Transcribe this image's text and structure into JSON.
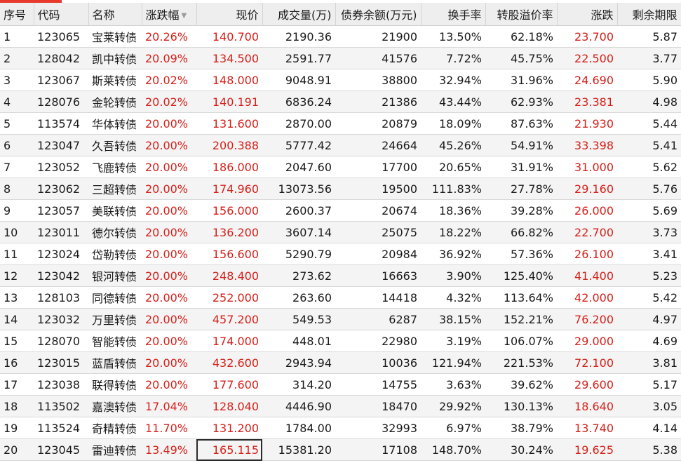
{
  "columns": [
    "序号",
    "代码",
    "名称",
    "涨跌幅",
    "现价",
    "成交量(万)",
    "债券余额(万元)",
    "换手率",
    "转股溢价率",
    "涨跌",
    "剩余期限"
  ],
  "sort_icon": "triangle-down-icon",
  "colors": {
    "up": "#d6201a",
    "accent": "#e8392d"
  },
  "rows": [
    [
      "1",
      "123065",
      "宝莱转债",
      "20.26%",
      "140.700",
      "2190.36",
      "21900",
      "13.50%",
      "62.18%",
      "23.700",
      "5.87"
    ],
    [
      "2",
      "128042",
      "凯中转债",
      "20.09%",
      "134.500",
      "2591.77",
      "41576",
      "7.72%",
      "45.75%",
      "22.500",
      "3.77"
    ],
    [
      "3",
      "123067",
      "斯莱转债",
      "20.02%",
      "148.000",
      "9048.91",
      "38800",
      "32.94%",
      "31.96%",
      "24.690",
      "5.90"
    ],
    [
      "4",
      "128076",
      "金轮转债",
      "20.02%",
      "140.191",
      "6836.24",
      "21386",
      "43.44%",
      "62.93%",
      "23.381",
      "4.98"
    ],
    [
      "5",
      "113574",
      "华体转债",
      "20.00%",
      "131.600",
      "2870.00",
      "20879",
      "18.09%",
      "87.63%",
      "21.930",
      "5.44"
    ],
    [
      "6",
      "123047",
      "久吾转债",
      "20.00%",
      "200.388",
      "5777.42",
      "24664",
      "45.26%",
      "54.91%",
      "33.398",
      "5.41"
    ],
    [
      "7",
      "123052",
      "飞鹿转债",
      "20.00%",
      "186.000",
      "2047.60",
      "17700",
      "20.65%",
      "31.91%",
      "31.000",
      "5.62"
    ],
    [
      "8",
      "123062",
      "三超转债",
      "20.00%",
      "174.960",
      "13073.56",
      "19500",
      "111.83%",
      "27.78%",
      "29.160",
      "5.76"
    ],
    [
      "9",
      "123057",
      "美联转债",
      "20.00%",
      "156.000",
      "2600.37",
      "20674",
      "18.36%",
      "39.28%",
      "26.000",
      "5.69"
    ],
    [
      "10",
      "123011",
      "德尔转债",
      "20.00%",
      "136.200",
      "3607.14",
      "25075",
      "18.22%",
      "66.82%",
      "22.700",
      "3.73"
    ],
    [
      "11",
      "123024",
      "岱勒转债",
      "20.00%",
      "156.600",
      "5290.79",
      "20984",
      "36.92%",
      "57.36%",
      "26.100",
      "3.41"
    ],
    [
      "12",
      "123042",
      "银河转债",
      "20.00%",
      "248.400",
      "273.62",
      "16663",
      "3.90%",
      "125.40%",
      "41.400",
      "5.23"
    ],
    [
      "13",
      "128103",
      "同德转债",
      "20.00%",
      "252.000",
      "263.60",
      "14418",
      "4.32%",
      "113.64%",
      "42.000",
      "5.42"
    ],
    [
      "14",
      "123032",
      "万里转债",
      "20.00%",
      "457.200",
      "549.53",
      "6287",
      "38.15%",
      "152.21%",
      "76.200",
      "4.97"
    ],
    [
      "15",
      "128070",
      "智能转债",
      "20.00%",
      "174.000",
      "448.01",
      "22980",
      "3.19%",
      "106.07%",
      "29.000",
      "4.69"
    ],
    [
      "16",
      "123015",
      "蓝盾转债",
      "20.00%",
      "432.600",
      "2943.94",
      "10036",
      "121.94%",
      "221.53%",
      "72.100",
      "3.81"
    ],
    [
      "17",
      "123038",
      "联得转债",
      "20.00%",
      "177.600",
      "314.20",
      "14755",
      "3.63%",
      "39.62%",
      "29.600",
      "5.17"
    ],
    [
      "18",
      "113502",
      "嘉澳转债",
      "17.04%",
      "128.040",
      "4446.90",
      "18470",
      "29.92%",
      "130.13%",
      "18.640",
      "3.05"
    ],
    [
      "19",
      "113524",
      "奇精转债",
      "11.70%",
      "131.200",
      "1784.00",
      "32993",
      "6.97%",
      "38.79%",
      "13.740",
      "4.14"
    ],
    [
      "20",
      "123045",
      "雷迪转债",
      "13.49%",
      "165.115",
      "15381.20",
      "17108",
      "148.70%",
      "30.24%",
      "19.625",
      "5.38"
    ]
  ]
}
